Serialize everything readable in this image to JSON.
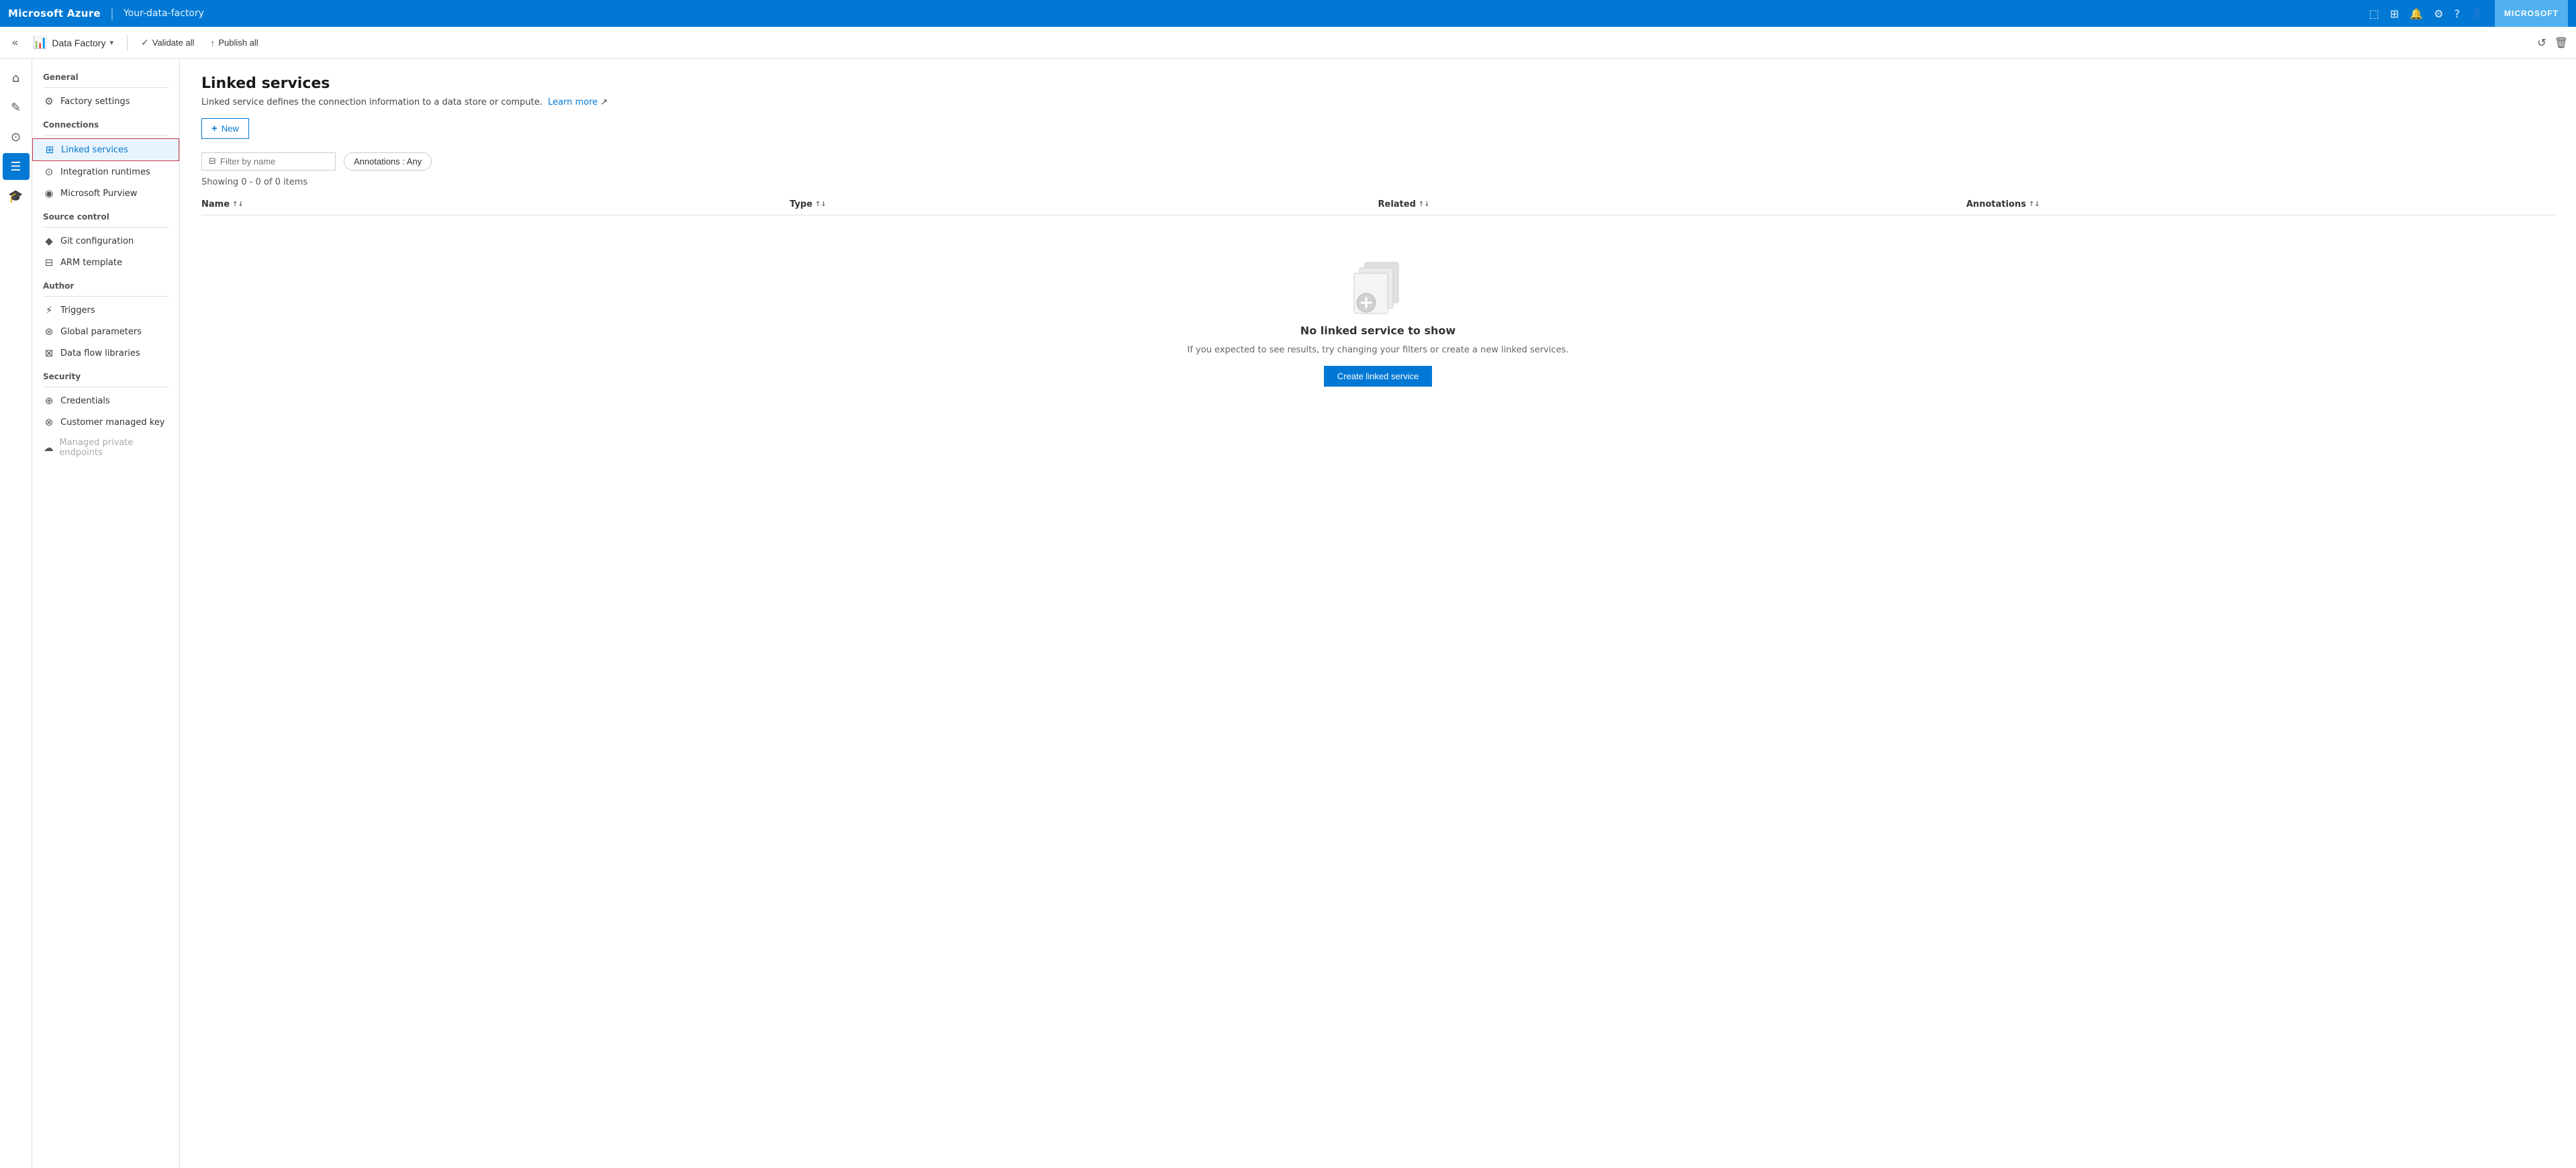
{
  "topbar": {
    "brand": "Microsoft Azure",
    "separator": "|",
    "instance": "Your-data-factory",
    "user_label": "MICROSOFT"
  },
  "toolbar": {
    "collapse_label": "«",
    "df_label": "Data Factory",
    "validate_all_label": "Validate all",
    "publish_all_label": "Publish all",
    "refresh_icon": "↺",
    "delete_icon": "🗑"
  },
  "icon_sidebar": {
    "items": [
      {
        "name": "home-icon",
        "glyph": "⌂",
        "active": false
      },
      {
        "name": "pencil-icon",
        "glyph": "✎",
        "active": false
      },
      {
        "name": "monitor-icon",
        "glyph": "⊙",
        "active": false
      },
      {
        "name": "manage-icon",
        "glyph": "📋",
        "active": true
      },
      {
        "name": "learn-icon",
        "glyph": "🎓",
        "active": false
      }
    ]
  },
  "nav": {
    "general_header": "General",
    "factory_settings_label": "Factory settings",
    "connections_header": "Connections",
    "linked_services_label": "Linked services",
    "integration_runtimes_label": "Integration runtimes",
    "microsoft_purview_label": "Microsoft Purview",
    "source_control_header": "Source control",
    "git_configuration_label": "Git configuration",
    "arm_template_label": "ARM template",
    "author_header": "Author",
    "triggers_label": "Triggers",
    "global_parameters_label": "Global parameters",
    "data_flow_libraries_label": "Data flow libraries",
    "security_header": "Security",
    "credentials_label": "Credentials",
    "customer_managed_key_label": "Customer managed key",
    "managed_private_endpoints_label": "Managed private endpoints"
  },
  "page": {
    "title": "Linked services",
    "description": "Linked service defines the connection information to a data store or compute.",
    "learn_more_label": "Learn more",
    "new_button_label": "New",
    "filter_placeholder": "Filter by name",
    "annotations_label": "Annotations : Any",
    "showing_text": "Showing 0 - 0 of 0 items",
    "columns": {
      "name": "Name",
      "type": "Type",
      "related": "Related",
      "annotations": "Annotations"
    },
    "empty_state": {
      "title": "No linked service to show",
      "description": "If you expected to see results, try changing your filters or create a new linked services.",
      "create_button_label": "Create linked service"
    }
  }
}
